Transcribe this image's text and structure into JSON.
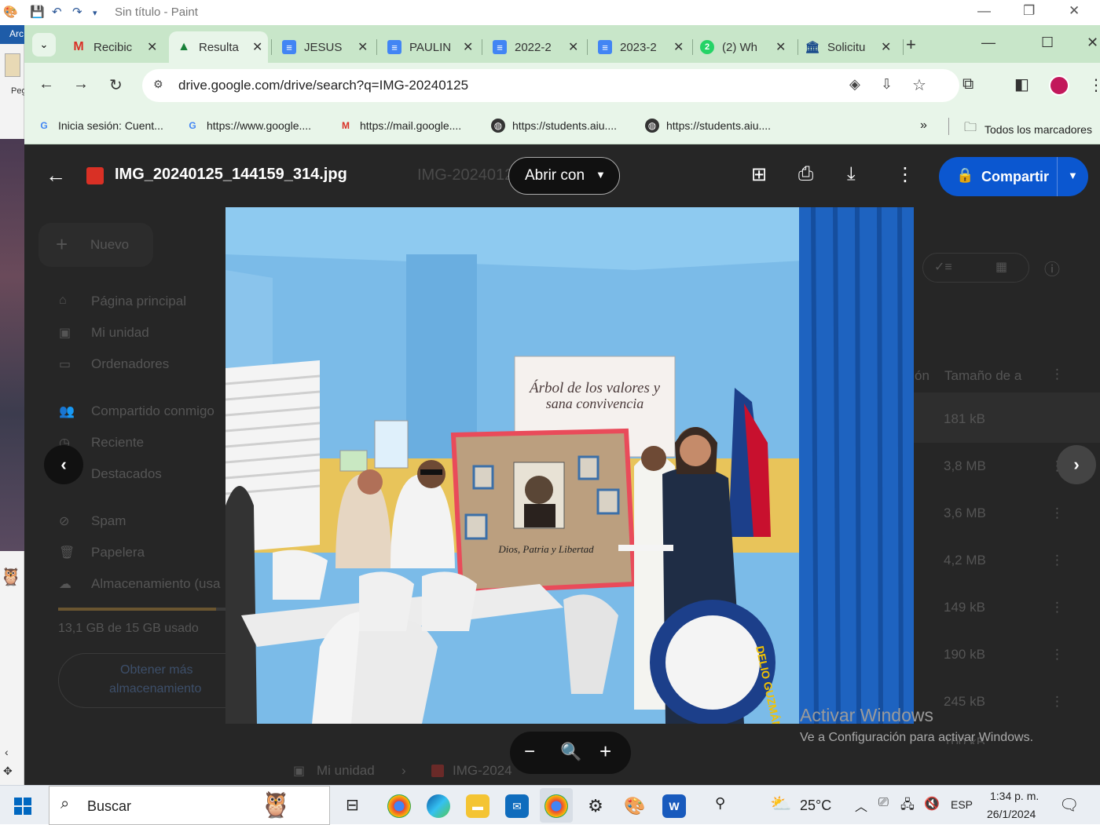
{
  "paint": {
    "title": "Sin título - Paint",
    "ribbon_tab": "Arc",
    "left_label": "Peg"
  },
  "chrome": {
    "tabs": [
      {
        "label": "Recibic",
        "icon": "gmail-icon"
      },
      {
        "label": "Resulta",
        "icon": "drive-icon",
        "active": true
      },
      {
        "label": "JESUS",
        "icon": "docs-icon"
      },
      {
        "label": "PAULIN",
        "icon": "docs-icon"
      },
      {
        "label": "2022-2",
        "icon": "docs-icon"
      },
      {
        "label": "2023-2",
        "icon": "docs-icon"
      },
      {
        "label": "(2) Wh",
        "icon": "whatsapp-icon",
        "badge": "2"
      },
      {
        "label": "Solicitu",
        "icon": "building-icon"
      }
    ],
    "url": "drive.google.com/drive/search?q=IMG-20240125",
    "bookmarks": [
      {
        "label": "Inicia sesión: Cuent...",
        "icon": "google-icon"
      },
      {
        "label": "https://www.google....",
        "icon": "google-icon"
      },
      {
        "label": "https://mail.google....",
        "icon": "gmail-icon"
      },
      {
        "label": "https://students.aiu....",
        "icon": "globe-icon"
      },
      {
        "label": "https://students.aiu....",
        "icon": "globe-icon"
      }
    ],
    "all_bookmarks": "Todos los marcadores"
  },
  "drive": {
    "search_placeholder": "IMG-20240125",
    "new_button": "Nuevo",
    "nav": [
      "Página principal",
      "Mi unidad",
      "Ordenadores",
      "Compartido conmigo",
      "Reciente",
      "Destacados",
      "Spam",
      "Papelera",
      "Almacenamiento (usa"
    ],
    "storage_used": "13,1 GB de 15 GB usado",
    "storage_fraction": 0.873,
    "get_more_line1": "Obtener más",
    "get_more_line2": "almacenamiento",
    "col_partial": "ón",
    "col_size": "Tamaño de a",
    "sizes": [
      "181 kB",
      "3,8 MB",
      "3,6 MB",
      "4,2 MB",
      "149 kB",
      "190 kB",
      "245 kB",
      "100 kB"
    ],
    "breadcrumb_root": "Mi unidad",
    "breadcrumb_file": "IMG-2024"
  },
  "viewer": {
    "file_name": "IMG_20240125_144159_314.jpg",
    "open_with": "Abrir con",
    "share": "Compartir"
  },
  "photo_text": {
    "banner_line1": "Árbol de los valores y",
    "banner_line2": "sana convivencia",
    "board_caption": "Dios, Patria y Libertad",
    "seal_text": "DELIO GUZMÁN"
  },
  "watermark": {
    "title": "Activar Windows",
    "subtitle": "Ve a Configuración para activar Windows."
  },
  "taskbar": {
    "search": "Buscar",
    "weather": "25°C",
    "lang": "ESP",
    "time": "1:34 p. m.",
    "date": "26/1/2024"
  },
  "colors": {
    "chrome_tabstrip": "#c8e6c9",
    "chrome_toolbar": "#e8f5e9",
    "share_blue": "#0b57d0",
    "viewer_bg": "#1f1f1f"
  }
}
